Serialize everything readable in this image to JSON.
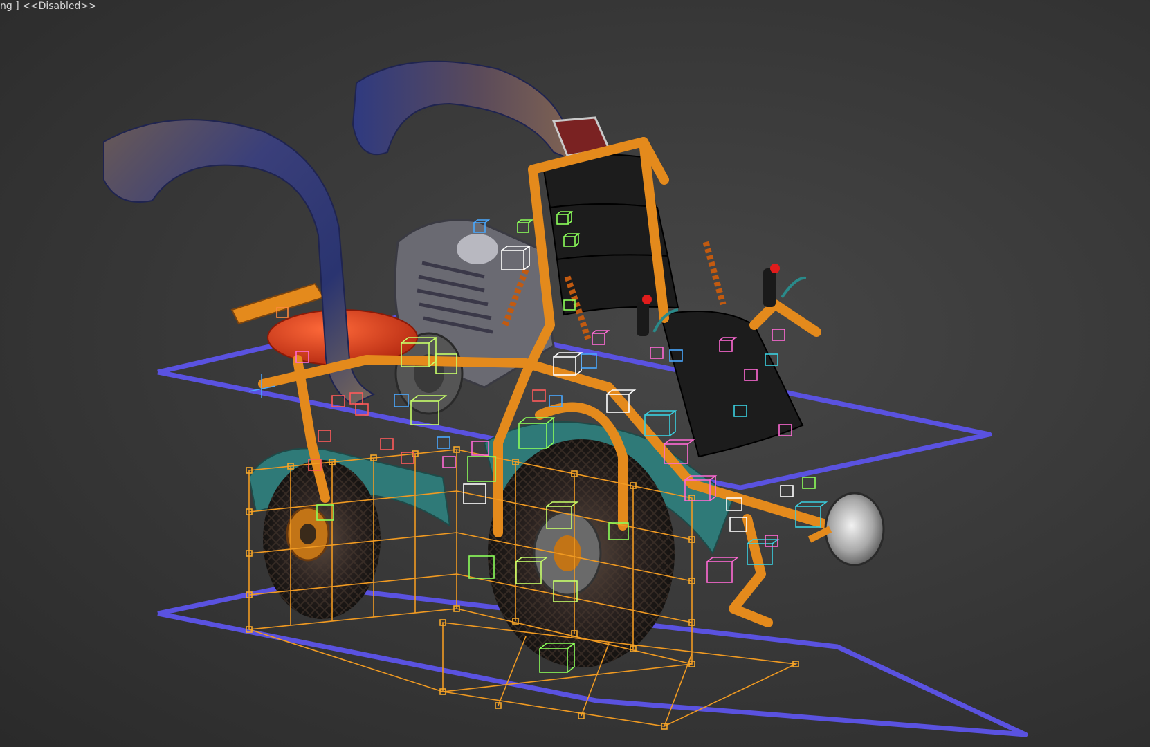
{
  "viewport": {
    "label_prefix": "ng ]",
    "label_state": "<<Disabled>>"
  },
  "colors": {
    "background": "#3a3a3a",
    "bounding_cage": "#5a52e0",
    "frame_orange": "#e48a1c",
    "lattice_orange": "#f09a22",
    "exhaust_blue": "#2f3a78",
    "fender_teal": "#2f7a78",
    "fuel_tank_red": "#d63a1a",
    "seat_black": "#1c1c1c",
    "helper_colors": [
      "#ff8a3d",
      "#4aa8ff",
      "#8cff5a",
      "#ff6ad5",
      "#ffffff",
      "#3ad0e0",
      "#ff5a5a",
      "#c7ff6a"
    ]
  },
  "scene": {
    "model": "motorcycle",
    "parts": [
      "exhaust-pipe-left",
      "exhaust-pipe-right",
      "engine",
      "fuel-tank",
      "seat",
      "frame",
      "rear-wheel",
      "front-wheel",
      "headlight",
      "shock-absorbers",
      "handlebars"
    ],
    "modifier_cage": "bounding-box",
    "ffd_lattice": "visible"
  }
}
